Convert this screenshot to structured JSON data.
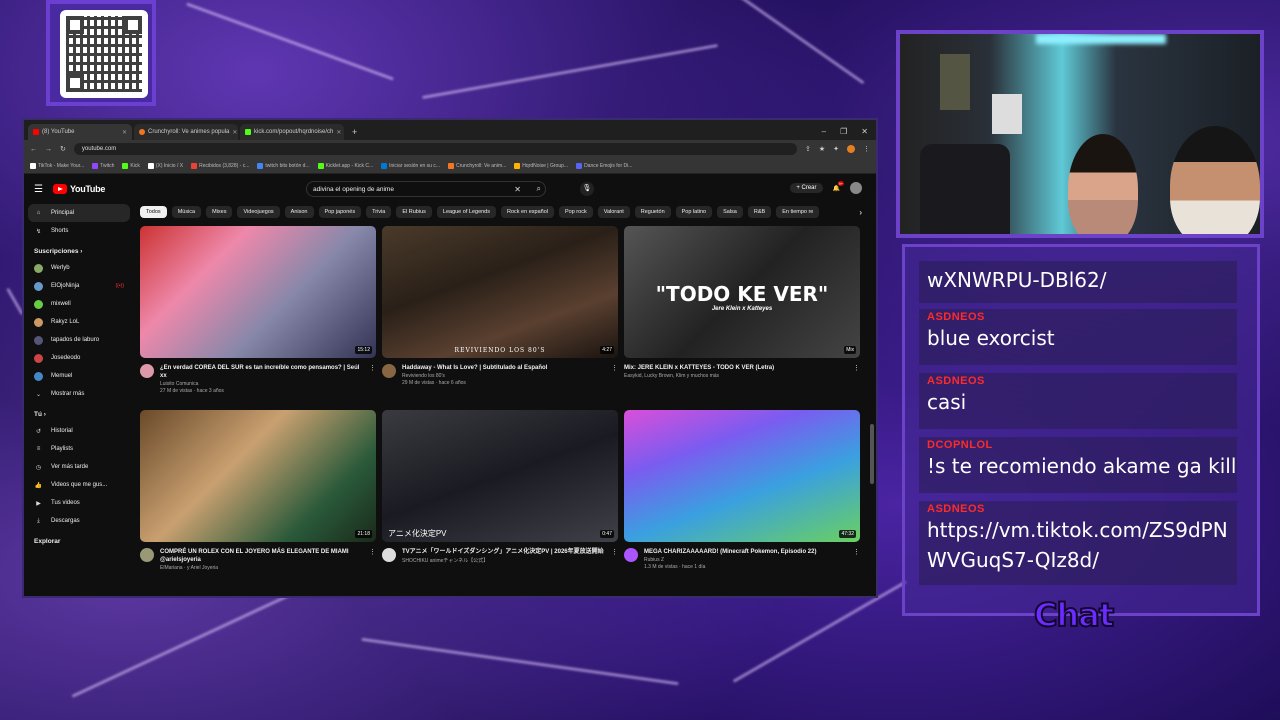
{
  "browser": {
    "tabs": [
      {
        "label": "(8) YouTube",
        "color": "#ff0000"
      },
      {
        "label": "Crunchyroll: Ve animes popula",
        "color": "#f47521"
      },
      {
        "label": "kick.com/popout/hqrdnoise/ch",
        "color": "#53fc18"
      }
    ],
    "url": "youtube.com",
    "bookmarks": [
      "TikTok - Make Your...",
      "Twitch",
      "Kick",
      "(X) Inicio / X",
      "Recibidos (3,828) - c...",
      "twitch bits botón d...",
      "Kicklet.app - Kick C...",
      "Iniciar sesión en su c...",
      "Crunchyroll: Ve anim...",
      "HqrdNoise | Group...",
      "Dance Emojis for Di..."
    ]
  },
  "youtube": {
    "logo": "YouTube",
    "search_value": "adivina el opening de anime",
    "create_label": "Crear",
    "notif_count": "9+",
    "sidebar": {
      "main": [
        {
          "label": "Principal",
          "icon": "home-icon",
          "active": true
        },
        {
          "label": "Shorts",
          "icon": "shorts-icon"
        }
      ],
      "subs_title": "Suscripciones",
      "subs": [
        {
          "label": "Werlyb",
          "color": "#8a6"
        },
        {
          "label": "ElOjoNinja",
          "color": "#69c",
          "live": true
        },
        {
          "label": "mixwell",
          "color": "#6c4"
        },
        {
          "label": "Rakyz LoL",
          "color": "#c96"
        },
        {
          "label": "tapados de laburo",
          "color": "#557"
        },
        {
          "label": "Josedeodo",
          "color": "#c44"
        },
        {
          "label": "Memuel",
          "color": "#48c"
        }
      ],
      "show_more": "Mostrar más",
      "you_title": "Tú",
      "you": [
        {
          "label": "Historial",
          "icon": "history-icon"
        },
        {
          "label": "Playlists",
          "icon": "playlist-icon"
        },
        {
          "label": "Ver más tarde",
          "icon": "clock-icon"
        },
        {
          "label": "Videos que me gus...",
          "icon": "like-icon"
        },
        {
          "label": "Tus videos",
          "icon": "video-icon"
        },
        {
          "label": "Descargas",
          "icon": "download-icon"
        }
      ],
      "explore_title": "Explorar"
    },
    "chips": [
      "Todos",
      "Música",
      "Mixes",
      "Videojuegos",
      "Anison",
      "Pop japonés",
      "Trivia",
      "El Rubius",
      "League of Legends",
      "Rock en español",
      "Pop rock",
      "Valorant",
      "Reguetón",
      "Pop latino",
      "Salsa",
      "R&B",
      "En tiempo re"
    ],
    "videos": [
      {
        "title": "¿En verdad COREA DEL SUR es tan increíble como pensamos? | Seúl xx",
        "channel": "Luisito Comunica",
        "stats": "27 M de vistas · hace 3 años",
        "duration": "15:12",
        "bg": "linear-gradient(135deg,#c33 0%,#e8a 30%,#88a 60%,#335 100%)",
        "avatar": "#d9a"
      },
      {
        "title": "Haddaway - What Is Love? | Subtitulado al Español",
        "channel": "Reviviendo los 80's",
        "stats": "29 M de vistas · hace 6 años",
        "duration": "4:27",
        "overlay": "REVIVIENDO LOS 80'S",
        "bg": "linear-gradient(160deg,#4a3a2a 0%,#2a2018 40%,#5a4030 70%,#1a1410 100%)",
        "avatar": "#864"
      },
      {
        "title": "Mix: JERE KLEIN x KATTEYES - TODO K VER (Letra)",
        "channel": "Easykid, Lucky Brown, Klim y muchos más",
        "stats": "",
        "duration": "Mix",
        "overlay": "\"TODO KE VER\"",
        "overlay_sub": "Jere Klein x Katteyes",
        "bg": "linear-gradient(135deg,#555 0%,#222 50%,#444 100%)",
        "avatar": ""
      },
      {
        "title": "COMPRÉ UN ROLEX CON EL JOYERO MÁS ELEGANTE DE MIAMI @arielsjoyeria",
        "channel": "ElMariana · y Ariel Joyeria",
        "stats": "",
        "duration": "21:18",
        "bg": "linear-gradient(135deg,#6a4a2a 0%,#c9a070 40%,#2a5a3a 75%,#1a2a1a 100%)",
        "avatar": "#997"
      },
      {
        "title": "TVアニメ「ワールドイズダンシング」アニメ化決定PV | 2026年夏放送開始",
        "channel": "SHOCHIKU animeチャンネル【公式】",
        "stats": "",
        "duration": "0:47",
        "overlay": "アニメ化決定PV",
        "bg": "linear-gradient(160deg,#3a3a40 0%,#1a1a22 50%,#404048 100%)",
        "avatar": "#ddd"
      },
      {
        "title": "MEGA CHARIZAAAAARD! (Minecraft Pokemon, Episodio 22)",
        "channel": "Rubius Z",
        "stats": "1.3 M de vistas · hace 1 día",
        "duration": "47:32",
        "bg": "linear-gradient(160deg,#d94fd9 0%,#7a5cf0 30%,#3aa0e0 60%,#6ad060 100%)",
        "avatar": "#a5f"
      }
    ]
  },
  "chat": {
    "messages": [
      {
        "author": "",
        "text": "wXNWRPU-DBl62/"
      },
      {
        "author": "ASDNEOS",
        "text": "blue exorcist"
      },
      {
        "author": "ASDNEOS",
        "text": "casi"
      },
      {
        "author": "DCOPNLOL",
        "text": "!s te recomiendo akame ga kill"
      },
      {
        "author": "ASDNEOS",
        "text": "https://vm.tiktok.com/ZS9dPN WVGuqS7-QIz8d/"
      }
    ],
    "label": "Chat"
  }
}
